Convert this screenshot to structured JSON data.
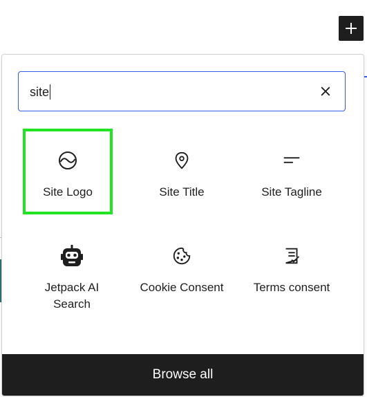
{
  "inserter": {
    "search": {
      "value": "site",
      "clear_icon": "close-icon"
    },
    "blocks": [
      {
        "label": "Site Logo",
        "icon": "site-logo-icon",
        "selected": true
      },
      {
        "label": "Site Title",
        "icon": "map-marker-icon",
        "selected": false
      },
      {
        "label": "Site Tagline",
        "icon": "tagline-icon",
        "selected": false
      },
      {
        "label": "Jetpack AI Search",
        "icon": "robot-icon",
        "selected": false
      },
      {
        "label": "Cookie Consent",
        "icon": "cookie-icon",
        "selected": false
      },
      {
        "label": "Terms consent",
        "icon": "terms-consent-icon",
        "selected": false
      }
    ],
    "browse_all_label": "Browse all"
  },
  "toolbar": {
    "add_icon": "plus-icon"
  },
  "colors": {
    "accent": "#3858e9",
    "highlight": "#22e322",
    "dark": "#1e1e1e"
  }
}
